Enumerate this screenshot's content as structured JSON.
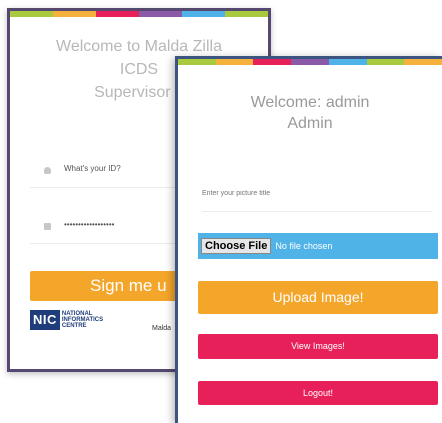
{
  "login": {
    "title_lines": [
      "Welcome to Malda Zilla",
      "ICDS",
      "Supervisor L"
    ],
    "user_field_placeholder": "What's your ID?",
    "password_value": "••••••••••••••••••",
    "signin_label": "Sign me u",
    "logo": {
      "abbr": "NIC",
      "line1": "NATIONAL",
      "line2": "INFORMATICS",
      "line3": "CENTRE",
      "place": "Malda"
    }
  },
  "admin": {
    "title_line1": "Welcome: admin",
    "title_line2": "Admin",
    "picture_title_placeholder": "Enter your picture title",
    "choose_file_label": "Choose File",
    "no_file_label": "No file chosen",
    "upload_label": "Upload Image!",
    "view_label": "View Images!",
    "logout_label": "Logout!"
  },
  "colors": {
    "stripe": [
      "#a9c93e",
      "#f4b13c",
      "#e8205a",
      "#8a5aa8",
      "#4fb3e8",
      "#a9c93e",
      "#f4b13c",
      "#e8205a"
    ],
    "accent_orange": "#f4a62a",
    "accent_pink": "#e8205a",
    "file_blue": "#4fb3e8"
  }
}
